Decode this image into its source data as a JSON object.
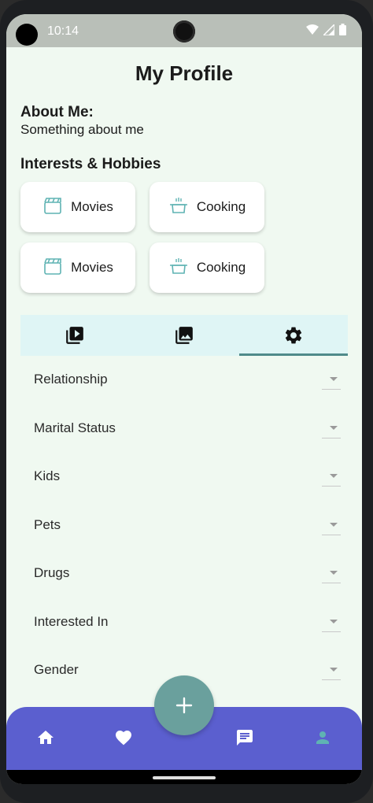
{
  "status_bar": {
    "time": "10:14"
  },
  "page": {
    "title": "My Profile"
  },
  "about": {
    "label": "About Me:",
    "text": "Something about me"
  },
  "interests": {
    "label": "Interests & Hobbies",
    "chips": [
      {
        "label": "Movies",
        "icon": "movie-clapper-icon"
      },
      {
        "label": "Cooking",
        "icon": "cooking-pot-icon"
      },
      {
        "label": "Movies",
        "icon": "movie-clapper-icon"
      },
      {
        "label": "Cooking",
        "icon": "cooking-pot-icon"
      }
    ]
  },
  "tabs": [
    {
      "icon": "video-library-icon"
    },
    {
      "icon": "photo-library-icon"
    },
    {
      "icon": "settings-gear-icon",
      "selected": true
    }
  ],
  "settings": [
    {
      "label": "Relationship"
    },
    {
      "label": "Marital Status"
    },
    {
      "label": "Kids"
    },
    {
      "label": "Pets"
    },
    {
      "label": "Drugs"
    },
    {
      "label": "Interested In"
    },
    {
      "label": "Gender"
    }
  ],
  "nav": {
    "items": [
      {
        "icon": "home-icon"
      },
      {
        "icon": "heart-icon"
      },
      {
        "icon": "chat-icon"
      },
      {
        "icon": "person-icon"
      }
    ],
    "fab_icon": "plus-icon"
  },
  "colors": {
    "background": "#f0f9f1",
    "navbar": "#5b5fcf",
    "fab": "#6aa09d",
    "tab_bar": "#dff5f5",
    "accent_icon": "#5fb3b3"
  }
}
